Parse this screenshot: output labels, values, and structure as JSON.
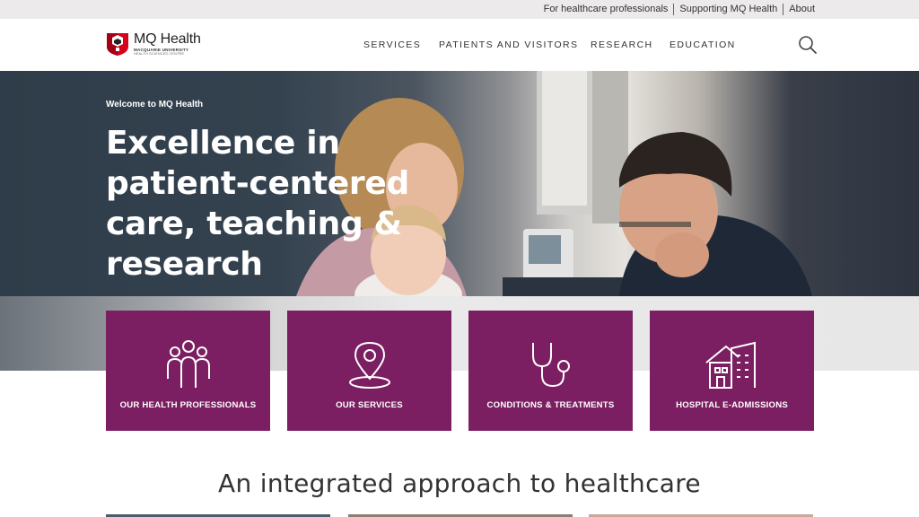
{
  "utility": {
    "links": [
      "For healthcare professionals",
      "Supporting MQ Health",
      "About"
    ]
  },
  "logo": {
    "title": "MQ Health",
    "line1": "MACQUARIE UNIVERSITY",
    "line2": "HEALTH SCIENCES CENTRE"
  },
  "nav": {
    "items": [
      "SERVICES",
      "PATIENTS AND VISITORS",
      "RESEARCH",
      "EDUCATION"
    ]
  },
  "hero": {
    "kicker": "Welcome to MQ Health",
    "title": "Excellence in patient-centered care, teaching & research"
  },
  "tiles": [
    {
      "label": "OUR HEALTH PROFESSIONALS",
      "icon": "people-icon"
    },
    {
      "label": "OUR SERVICES",
      "icon": "location-pin-icon"
    },
    {
      "label": "CONDITIONS & TREATMENTS",
      "icon": "stethoscope-icon"
    },
    {
      "label": "HOSPITAL E-ADMISSIONS",
      "icon": "hospital-building-icon"
    }
  ],
  "section": {
    "heading": "An integrated approach to healthcare"
  },
  "colors": {
    "brand_plum": "#7c1f62",
    "logo_red": "#d6001c",
    "utility_bg": "#eceaeb"
  }
}
